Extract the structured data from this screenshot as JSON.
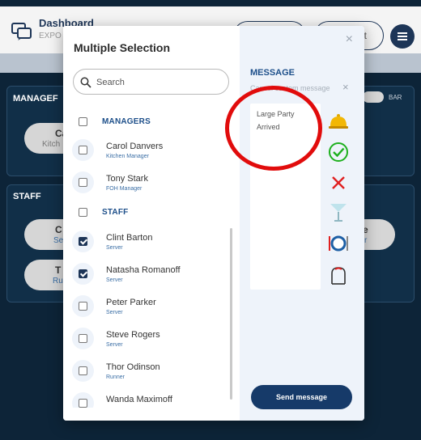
{
  "app": {
    "title": "Dashboard",
    "subtitle": "EXPO",
    "header_button_partial": "t"
  },
  "background": {
    "section_managers_label": "MANAGEF",
    "section_staff_label": "STAFF",
    "bar_label": "BAR",
    "chips": [
      {
        "line1": "Ca",
        "line2": "Kitch"
      },
      {
        "line1": "C",
        "line2": "Se"
      },
      {
        "line1": "T",
        "line2": "Ru"
      },
      {
        "line1": "e",
        "line2": "r"
      }
    ]
  },
  "modal": {
    "title": "Multiple Selection",
    "close_symbol": "×",
    "search": {
      "placeholder": "Search",
      "value": ""
    },
    "groups": [
      {
        "label": "MANAGERS",
        "checked": false,
        "members": [
          {
            "name": "Carol Danvers",
            "role": "Kitchen Manager",
            "checked": false
          },
          {
            "name": "Tony Stark",
            "role": "FOH Manager",
            "checked": false
          }
        ]
      },
      {
        "label": "STAFF",
        "checked": false,
        "members": [
          {
            "name": "Clint Barton",
            "role": "Server",
            "checked": true
          },
          {
            "name": "Natasha Romanoff",
            "role": "Server",
            "checked": true
          },
          {
            "name": "Peter Parker",
            "role": "Server",
            "checked": false
          },
          {
            "name": "Steve Rogers",
            "role": "Server",
            "checked": false
          },
          {
            "name": "Thor Odinson",
            "role": "Runner",
            "checked": false
          },
          {
            "name": "Wanda Maximoff",
            "role": "",
            "checked": false
          }
        ]
      }
    ],
    "message": {
      "title": "MESSAGE",
      "cancel_label": "Cancel custom message",
      "cancel_symbol": "×",
      "text_line1": "Large Party",
      "text_line2": "Arrived",
      "presets": [
        "bell-icon",
        "check-circle-icon",
        "x-mark-icon",
        "cocktail-glass-icon",
        "plate-icon",
        "bag-icon"
      ],
      "send_label": "Send message"
    }
  },
  "colors": {
    "accent": "#1d3557",
    "link": "#1d4f8a",
    "check": "#1db01d",
    "cross": "#e02020",
    "bell": "#f2b705",
    "annotation": "#e10c0c"
  }
}
